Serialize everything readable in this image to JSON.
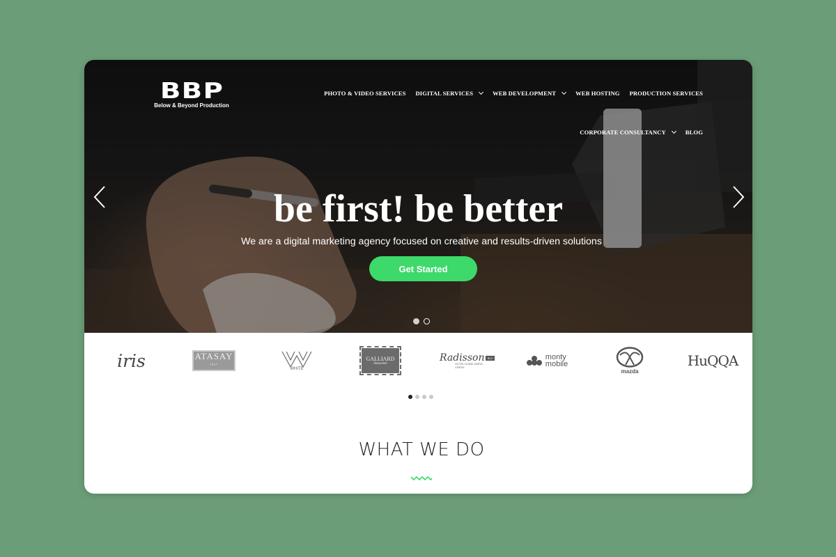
{
  "logo": {
    "mark": "BBP",
    "tagline": "Below & Beyond Production"
  },
  "nav": {
    "row1": [
      {
        "label": "PHOTO & VIDEO SERVICES",
        "dropdown": false
      },
      {
        "label": "DIGITAL SERVICES",
        "dropdown": true
      },
      {
        "label": "WEB DEVELOPMENT",
        "dropdown": true
      },
      {
        "label": "WEB HOSTING",
        "dropdown": false
      },
      {
        "label": "PRODUCTION SERVICES",
        "dropdown": false
      }
    ],
    "row2": [
      {
        "label": "CORPORATE CONSULTANCY",
        "dropdown": true
      },
      {
        "label": "BLOG",
        "dropdown": false
      }
    ]
  },
  "hero": {
    "headline": "be first! be better",
    "subline": "We are a digital marketing agency focused on creative and results-driven solutions",
    "cta_label": "Get Started",
    "slide_count": 2,
    "active_slide": 1,
    "cta_color": "#3dd96a"
  },
  "clients": {
    "logos": [
      {
        "name": "iris",
        "text": "iris"
      },
      {
        "name": "atasay",
        "text": "ATASAY",
        "sub": "1937"
      },
      {
        "name": "white",
        "text": "WHITE"
      },
      {
        "name": "galliard",
        "text": "GALLIARD",
        "sub": "limousine"
      },
      {
        "name": "radisson",
        "text": "Radisson",
        "badge": "BLU",
        "sub": "HOTEL DUBAI DEIRA CREEK"
      },
      {
        "name": "monty-mobile",
        "text1": "monty",
        "text2": "mobile"
      },
      {
        "name": "mazda",
        "text": "mazda"
      },
      {
        "name": "huqqa",
        "text": "HuQQA"
      }
    ],
    "page_count": 4,
    "active_page": 1
  },
  "section": {
    "title": "WHAT WE DO",
    "accent": "#3dd96a"
  }
}
